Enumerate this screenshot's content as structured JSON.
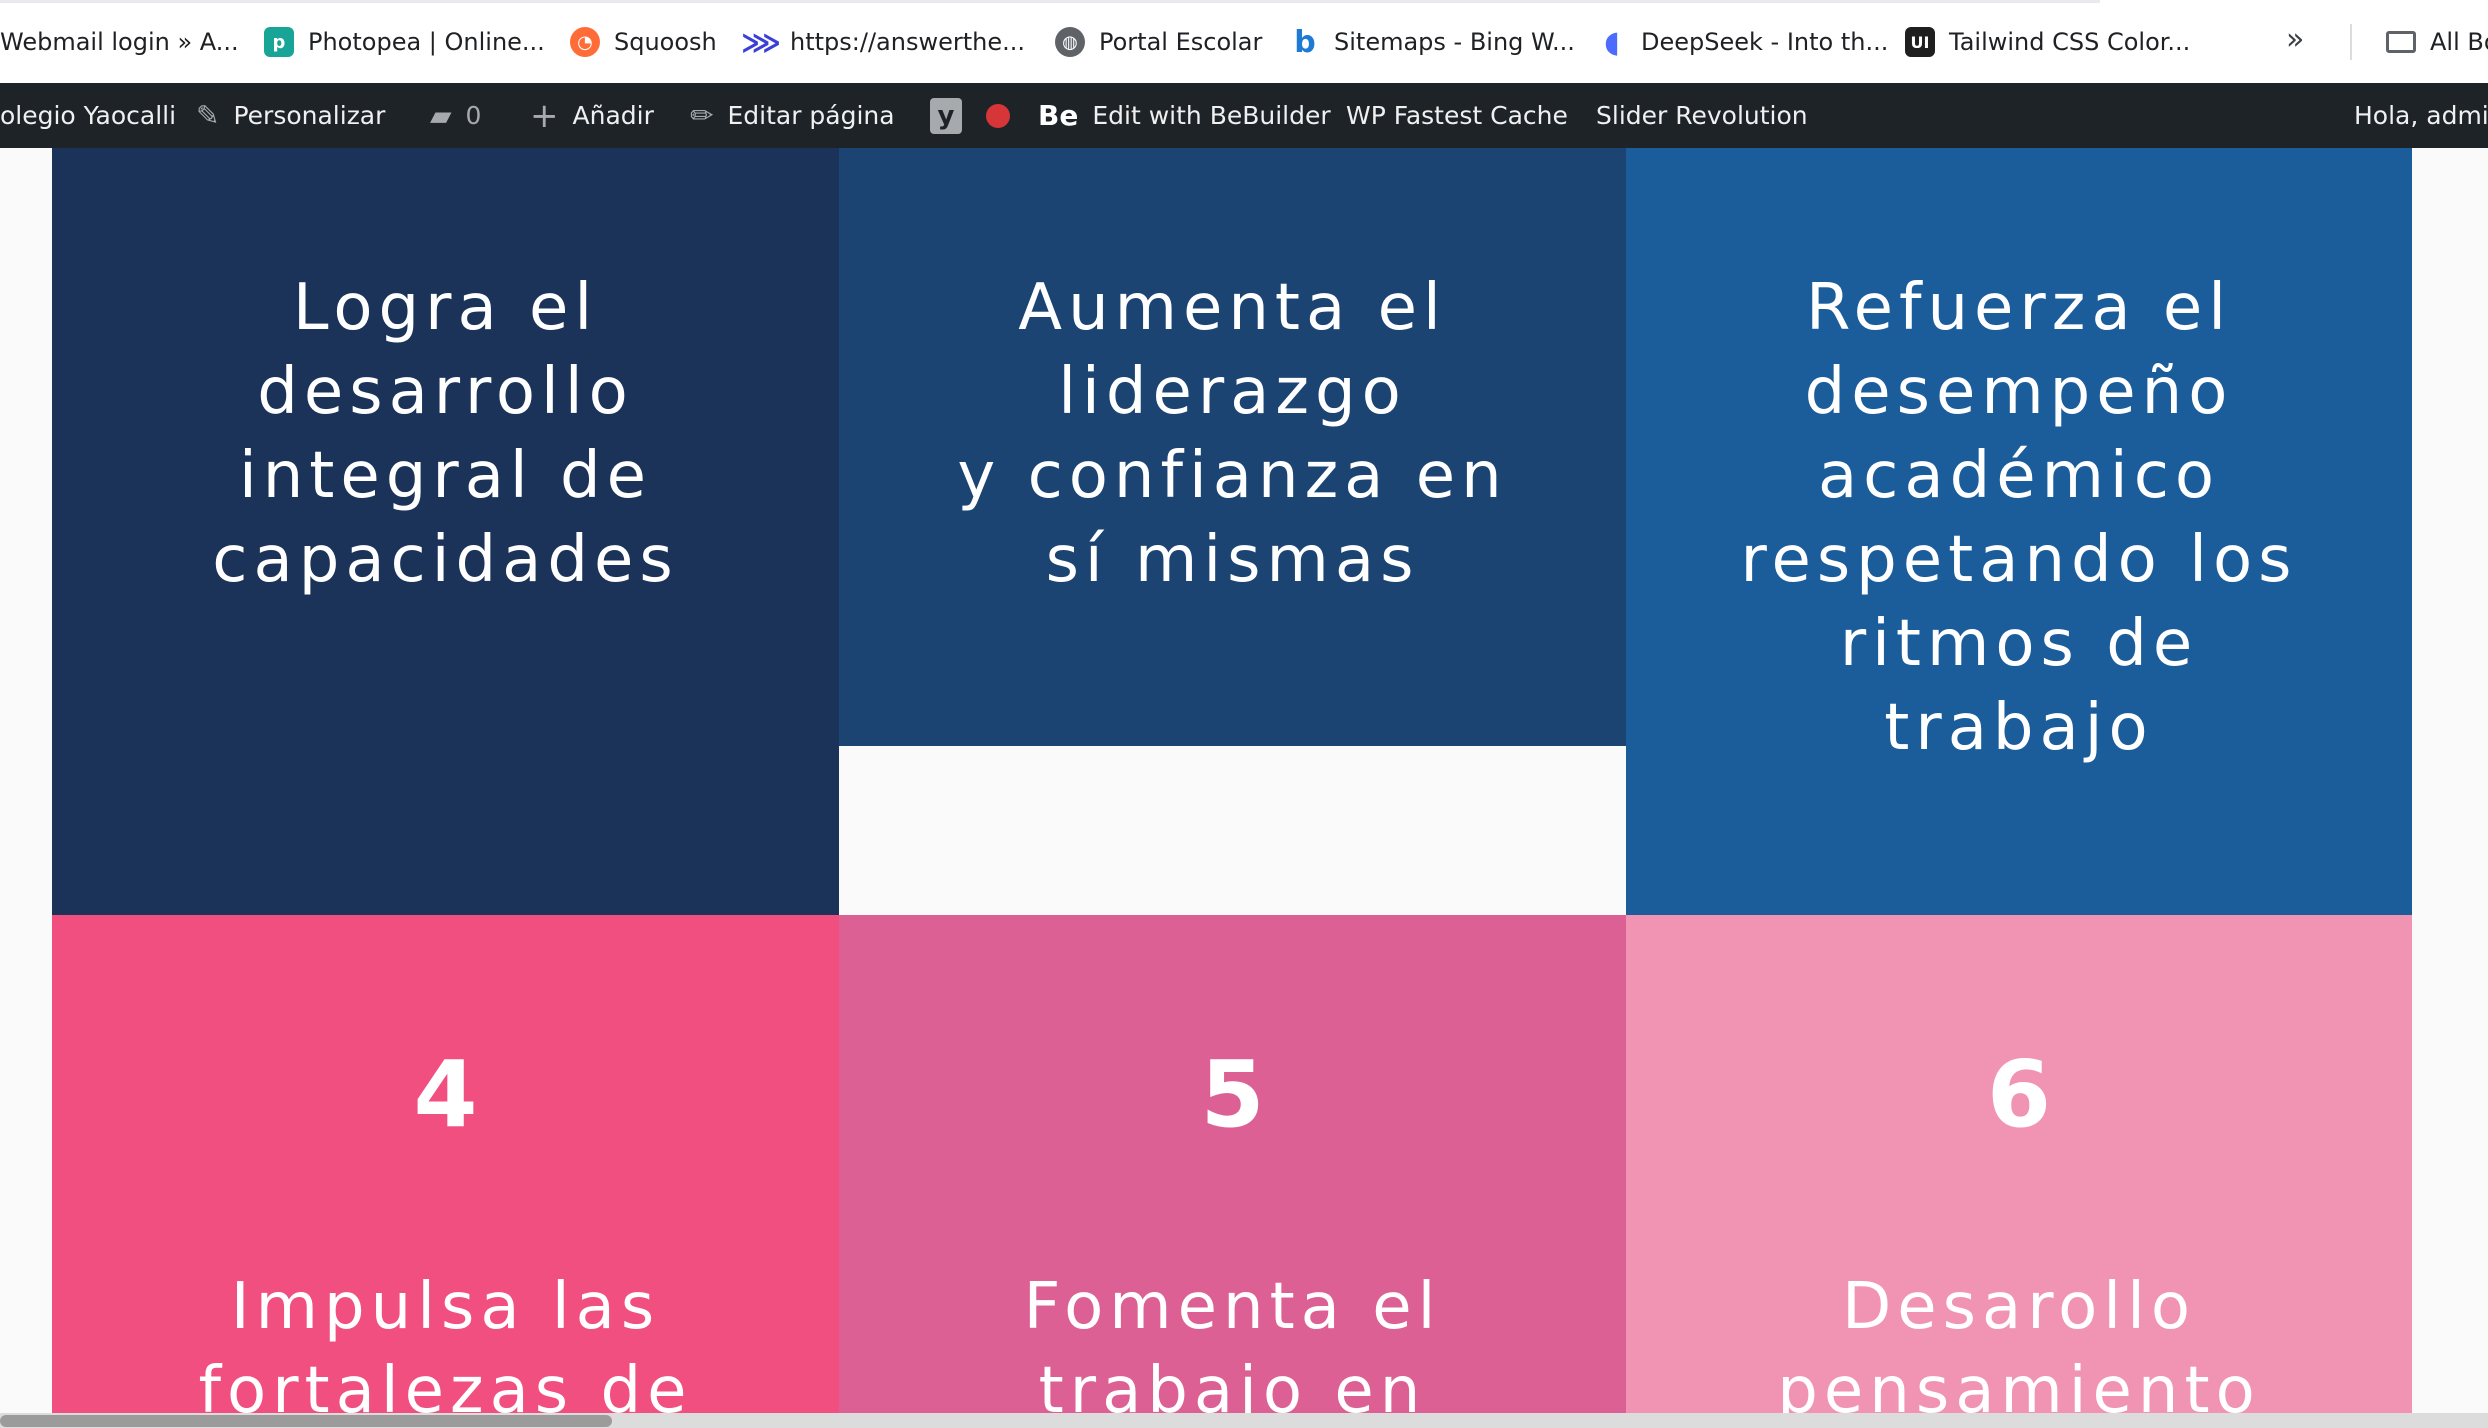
{
  "bookmarks": [
    {
      "label": "Webmail login » A...",
      "icon": "webmail-icon"
    },
    {
      "label": "Photopea | Online...",
      "icon": "photopea-icon"
    },
    {
      "label": "Squoosh",
      "icon": "squoosh-icon"
    },
    {
      "label": "https://answerthe...",
      "icon": "answerthepublic-icon"
    },
    {
      "label": "Portal Escolar",
      "icon": "globe-icon"
    },
    {
      "label": "Sitemaps - Bing W...",
      "icon": "bing-icon"
    },
    {
      "label": "DeepSeek - Into th...",
      "icon": "deepseek-icon"
    },
    {
      "label": "Tailwind CSS Color...",
      "icon": "tailwind-ui-icon"
    },
    {
      "label": "All Bo",
      "icon": "folder-icon"
    }
  ],
  "adminbar": {
    "site_name": "olegio Yaocalli",
    "customize": "Personalizar",
    "comments_count": "0",
    "add_new": "Añadir",
    "edit_page": "Editar página",
    "bebuilder_logo": "Be",
    "bebuilder": "Edit with BeBuilder",
    "fastest_cache": "WP Fastest Cache",
    "slider_revolution": "Slider Revolution",
    "greeting": "Hola, admin"
  },
  "tiles": [
    {
      "text": "Logra el\ndesarrollo\nintegral de\ncapacidades",
      "color": "#1b3358"
    },
    {
      "text": "Aumenta el\nliderazgo\ny confianza en\nsí mismas",
      "color": "#1b4472"
    },
    {
      "text": "Refuerza el\ndesempeño\nacadémico\nrespetando los\nritmos de\ntrabajo",
      "color": "#1b5c9b"
    },
    {
      "number": "4",
      "text": "Impulsa las\nfortalezas de",
      "color": "#f04f80"
    },
    {
      "number": "5",
      "text": "Fomenta el\ntrabajo en",
      "color": "#dc6094"
    },
    {
      "number": "6",
      "text": "Desarollo\npensamiento",
      "color": "#f194b3"
    }
  ]
}
